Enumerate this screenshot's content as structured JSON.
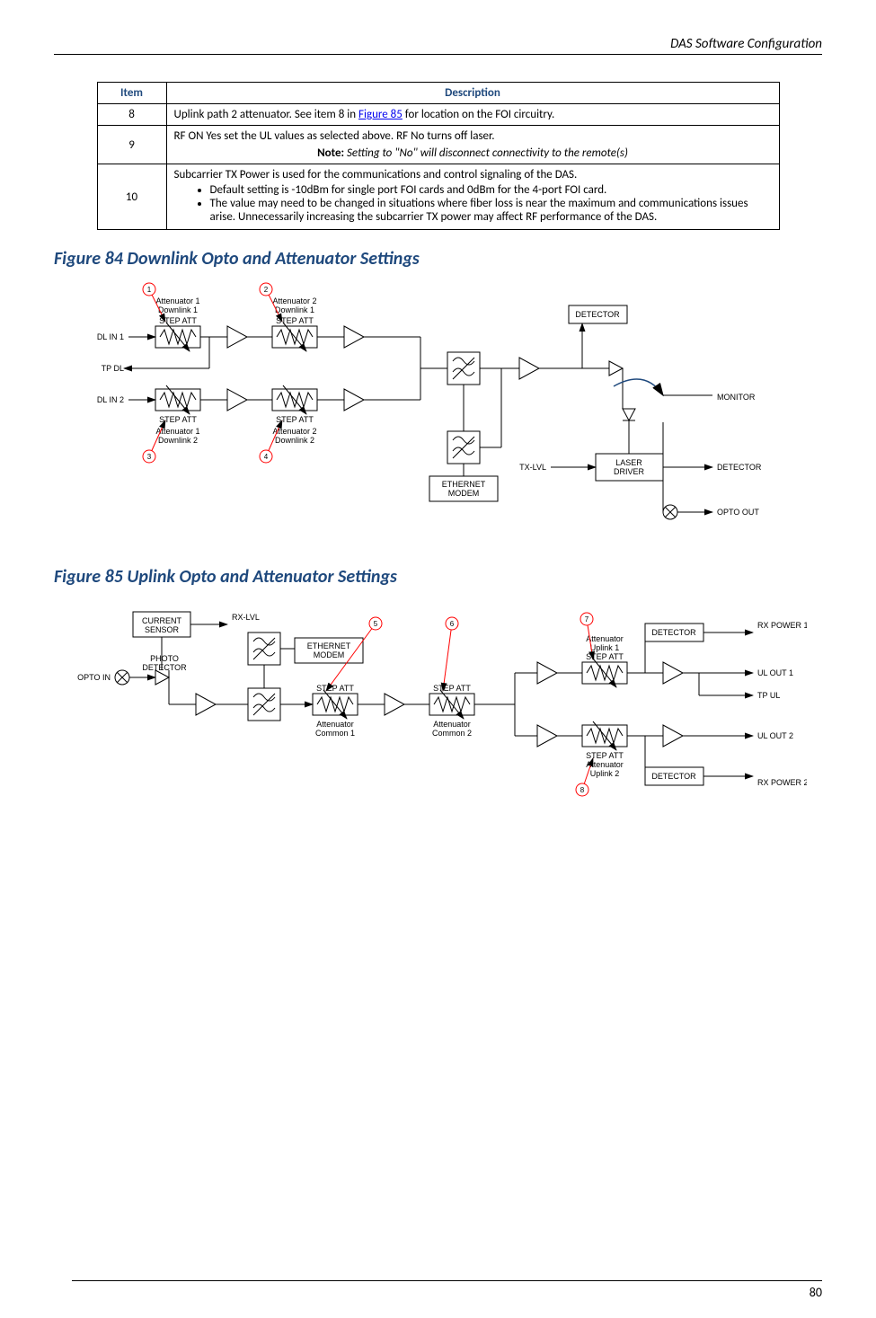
{
  "header": {
    "title": "DAS Software Configuration"
  },
  "footer": {
    "page": "80"
  },
  "table": {
    "headers": {
      "item": "Item",
      "desc": "Description"
    },
    "rows": [
      {
        "item": "8",
        "desc_prefix": "Uplink path 2 attenuator. See item 8 in ",
        "desc_link": "Figure 85",
        "desc_suffix": " for location on the FOI circuitry."
      },
      {
        "item": "9",
        "desc_line1": "RF ON   Yes set the UL values as selected above.  RF No turns off laser.",
        "note_label": "Note:",
        "note_text": "  Setting to \"No\" will disconnect connectivity to the remote(s)"
      },
      {
        "item": "10",
        "desc_line1": "Subcarrier TX Power is used for the communications and control signaling of the DAS.",
        "bullets": [
          "Default setting is -10dBm for single port FOI cards and 0dBm for the 4-port FOI card.",
          "The value may need to be changed in situations where fiber loss is near the maximum and communications issues arise. Unnecessarily increasing the subcarrier TX power may affect RF performance of the DAS."
        ]
      }
    ]
  },
  "figures": {
    "fig84": {
      "title": "Figure 84    Downlink Opto and Attenuator Settings"
    },
    "fig85": {
      "title": "Figure 85    Uplink Opto and Attenuator Settings"
    }
  },
  "diagram84": {
    "labels": {
      "att1dl1_l1": "Attenuator 1",
      "att1dl1_l2": "Downlink 1",
      "att2dl1_l1": "Attenuator 2",
      "att2dl1_l2": "Downlink 1",
      "att1dl2_l1": "Attenuator 1",
      "att1dl2_l2": "Downlink 2",
      "att2dl2_l1": "Attenuator 2",
      "att2dl2_l2": "Downlink 2",
      "step_att": "STEP ATT",
      "dl_in_1": "DL IN 1",
      "tp_dl": "TP DL",
      "dl_in_2": "DL IN 2",
      "detector": "DETECTOR",
      "monitor": "MONITOR",
      "tx_lvl": "TX-LVL",
      "laser_driver_l1": "LASER",
      "laser_driver_l2": "DRIVER",
      "detector2": "DETECTOR",
      "opto_out": "OPTO OUT",
      "eth_modem_l1": "ETHERNET",
      "eth_modem_l2": "MODEM"
    },
    "callouts": [
      "1",
      "2",
      "3",
      "4"
    ]
  },
  "diagram85": {
    "labels": {
      "current_sensor_l1": "CURRENT",
      "current_sensor_l2": "SENSOR",
      "rx_lvl": "RX-LVL",
      "eth_modem_l1": "ETHERNET",
      "eth_modem_l2": "MODEM",
      "photo_det_l1": "PHOTO",
      "photo_det_l2": "DETECTOR",
      "opto_in": "OPTO IN",
      "step_att": "STEP ATT",
      "att_common1_l1": "Attenuator",
      "att_common1_l2": "Common 1",
      "att_common2_l1": "Attenuator",
      "att_common2_l2": "Common 2",
      "att_ul1_l1": "Attenuator",
      "att_ul1_l2": "Uplink 1",
      "att_ul2_l1": "Attenuator",
      "att_ul2_l2": "Uplink 2",
      "detector": "DETECTOR",
      "rx_power1": "RX POWER 1",
      "ul_out1": "UL OUT 1",
      "tp_ul": "TP UL",
      "ul_out2": "UL OUT 2",
      "rx_power2": "RX POWER 2"
    },
    "callouts": [
      "5",
      "6",
      "7",
      "8"
    ]
  }
}
